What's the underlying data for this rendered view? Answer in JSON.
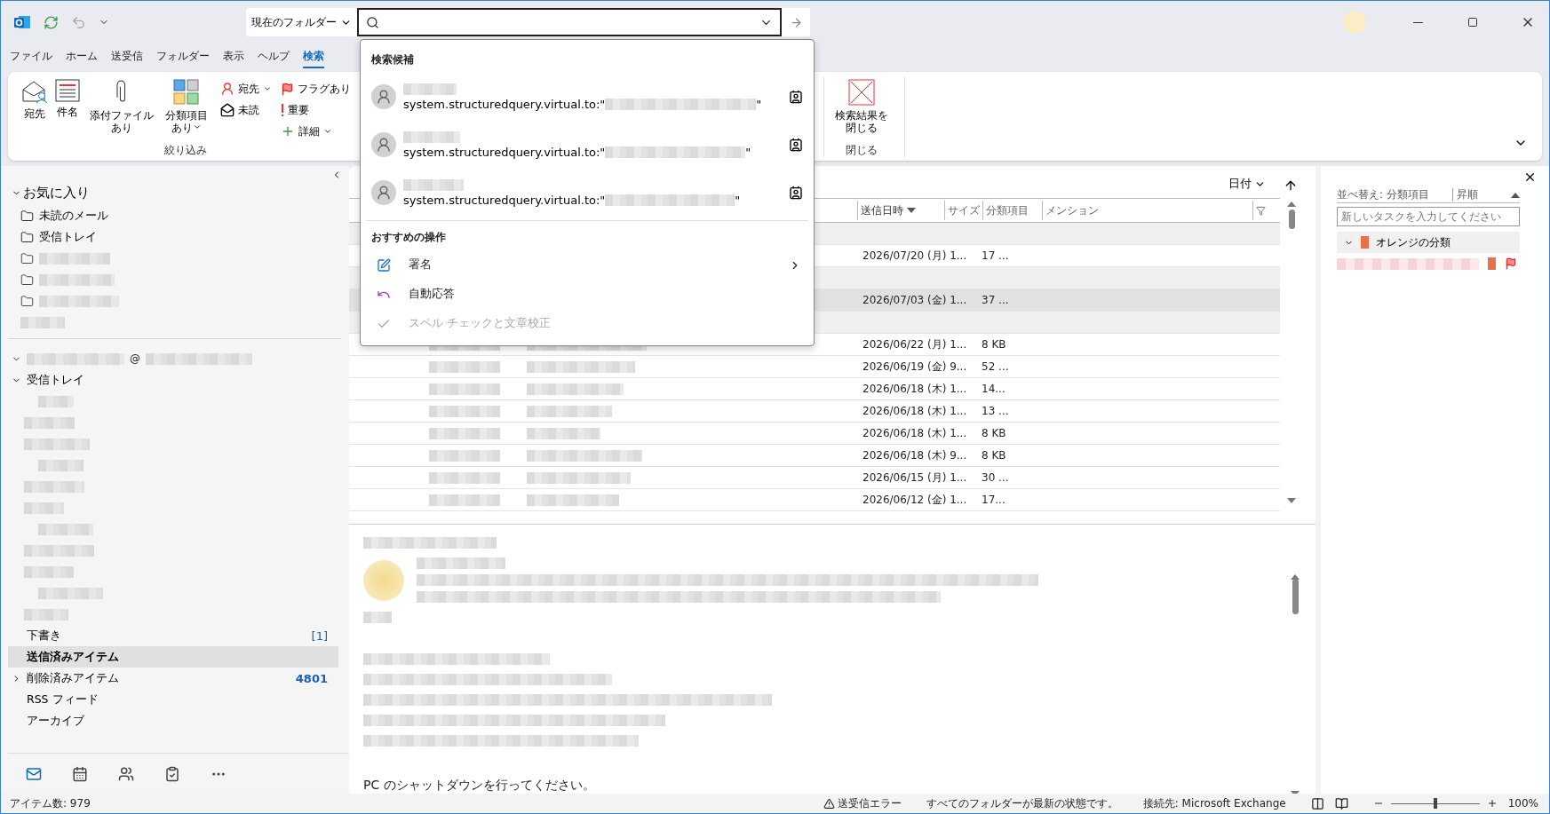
{
  "search": {
    "scope": "現在のフォルダー"
  },
  "menu_tabs": [
    {
      "label": "ファイル",
      "selected": false
    },
    {
      "label": "ホーム",
      "selected": false
    },
    {
      "label": "送受信",
      "selected": false
    },
    {
      "label": "フォルダー",
      "selected": false
    },
    {
      "label": "表示",
      "selected": false
    },
    {
      "label": "ヘルプ",
      "selected": false
    },
    {
      "label": "検索",
      "selected": true
    }
  ],
  "ribbon": {
    "groups": [
      {
        "label": "絞り込み",
        "items": [
          {
            "kind": "large",
            "label": "宛先",
            "dropdown": false
          },
          {
            "kind": "large",
            "label": "件名",
            "dropdown": false
          },
          {
            "kind": "large",
            "label": "添付ファイルあり",
            "dropdown": false
          },
          {
            "kind": "large",
            "label": "分類項目あり",
            "dropdown": true
          },
          {
            "kind": "small",
            "label": "宛先",
            "dropdown": true
          },
          {
            "kind": "small",
            "label": "未読",
            "dropdown": false
          },
          {
            "kind": "small",
            "label": "フラグあり",
            "dropdown": false
          },
          {
            "kind": "small",
            "label": "重要",
            "dropdown": false
          },
          {
            "kind": "small",
            "label": "詳細",
            "dropdown": true
          }
        ]
      },
      {
        "label": "閉じる",
        "items": [
          {
            "kind": "large",
            "label": "検索結果を閉じる",
            "dropdown": false
          }
        ]
      }
    ]
  },
  "search_dropdown": {
    "sections": [
      {
        "title": "検索候補",
        "items": [
          {
            "kind": "contact",
            "query_prefix": "system.structuredquery.virtual.to:\"",
            "query_suffix": "\""
          },
          {
            "kind": "contact",
            "query_prefix": "system.structuredquery.virtual.to:\"",
            "query_suffix": "\""
          },
          {
            "kind": "contact",
            "query_prefix": "system.structuredquery.virtual.to:\"",
            "query_suffix": "\""
          }
        ]
      },
      {
        "title": "おすすめの操作",
        "items": [
          {
            "kind": "action",
            "label": "署名",
            "submenu": true,
            "disabled": false
          },
          {
            "kind": "action",
            "label": "自動応答",
            "submenu": false,
            "disabled": false
          },
          {
            "kind": "action",
            "label": "スペル チェックと文章校正",
            "submenu": false,
            "disabled": true
          }
        ]
      }
    ]
  },
  "sidebar": {
    "favorites": {
      "label": "お気に入り",
      "expanded": true,
      "items": [
        {
          "kind": "folder",
          "label": "未読のメール"
        },
        {
          "kind": "folder",
          "label": "受信トレイ"
        },
        {
          "kind": "redacted-folder"
        },
        {
          "kind": "redacted-folder"
        },
        {
          "kind": "redacted-folder"
        },
        {
          "kind": "redacted"
        }
      ]
    },
    "account": {
      "visible_text": "@",
      "expanded": true
    },
    "folders": [
      {
        "kind": "folder",
        "label": "受信トレイ",
        "expanded": true,
        "selected": false,
        "children": [
          {
            "kind": "redacted"
          },
          {
            "kind": "redacted"
          },
          {
            "kind": "redacted"
          },
          {
            "kind": "redacted"
          },
          {
            "kind": "redacted"
          },
          {
            "kind": "redacted"
          },
          {
            "kind": "redacted"
          },
          {
            "kind": "redacted"
          },
          {
            "kind": "redacted"
          },
          {
            "kind": "redacted"
          },
          {
            "kind": "redacted"
          }
        ]
      },
      {
        "kind": "folder",
        "label": "下書き",
        "count": "[1]",
        "selected": false
      },
      {
        "kind": "folder",
        "label": "送信済みアイテム",
        "selected": true
      },
      {
        "kind": "folder",
        "label": "削除済みアイテム",
        "count": "4801",
        "expanded": false,
        "selected": false
      },
      {
        "kind": "folder",
        "label": "RSS フィード",
        "selected": false
      },
      {
        "kind": "folder",
        "label": "アーカイブ",
        "selected": false
      }
    ],
    "nav": [
      {
        "selected": true
      },
      {
        "selected": false
      },
      {
        "selected": false
      },
      {
        "selected": false
      },
      {
        "selected": false
      }
    ]
  },
  "message_list": {
    "arrange": "日付",
    "columns": [
      {
        "label": "送信日時",
        "sorted": true
      },
      {
        "label": "サイズ",
        "sorted": false
      },
      {
        "label": "分類項目",
        "sorted": false
      },
      {
        "label": "メンション",
        "sorted": false
      }
    ],
    "rows": [
      {
        "kind": "group"
      },
      {
        "kind": "item",
        "sent": "2026/07/20 (月) 1...",
        "size": "17 ...",
        "selected": false
      },
      {
        "kind": "group"
      },
      {
        "kind": "item",
        "sent": "2026/07/03 (金) 1...",
        "size": "37 ...",
        "selected": true
      },
      {
        "kind": "group"
      },
      {
        "kind": "item",
        "sent": "2026/06/22 (月) 1...",
        "size": "8 KB",
        "selected": false
      },
      {
        "kind": "item",
        "sent": "2026/06/19 (金) 9...",
        "size": "52 ...",
        "selected": false
      },
      {
        "kind": "item",
        "sent": "2026/06/18 (木) 1...",
        "size": "14...",
        "selected": false
      },
      {
        "kind": "item",
        "sent": "2026/06/18 (木) 1...",
        "size": "13 ...",
        "selected": false
      },
      {
        "kind": "item",
        "sent": "2026/06/18 (木) 1...",
        "size": "8 KB",
        "selected": false
      },
      {
        "kind": "item",
        "sent": "2026/06/18 (木) 9...",
        "size": "8 KB",
        "selected": false
      },
      {
        "kind": "item",
        "sent": "2026/06/15 (月) 1...",
        "size": "30 ...",
        "selected": false
      },
      {
        "kind": "item",
        "sent": "2026/06/12 (金) 1...",
        "size": "17...",
        "selected": false
      }
    ]
  },
  "reading_pane": {
    "last_line": "PC のシャットダウンを行ってください。"
  },
  "todo": {
    "sort_label": "並べ替え: 分類項目",
    "order": "昇順",
    "placeholder": "新しいタスクを入力してください",
    "group": {
      "label": "オレンジの分類",
      "expanded": true,
      "color": "#e8704a"
    },
    "tasks": [
      {
        "kind": "redacted",
        "flagged": true
      }
    ]
  },
  "status_bar": {
    "item_count": "アイテム数: 979",
    "error": "送受信エラー",
    "sync": "すべてのフォルダーが最新の状態です。",
    "connection": "接続先: Microsoft Exchange",
    "zoom": "100%",
    "zoom_slider": {
      "level": 0.5
    }
  }
}
